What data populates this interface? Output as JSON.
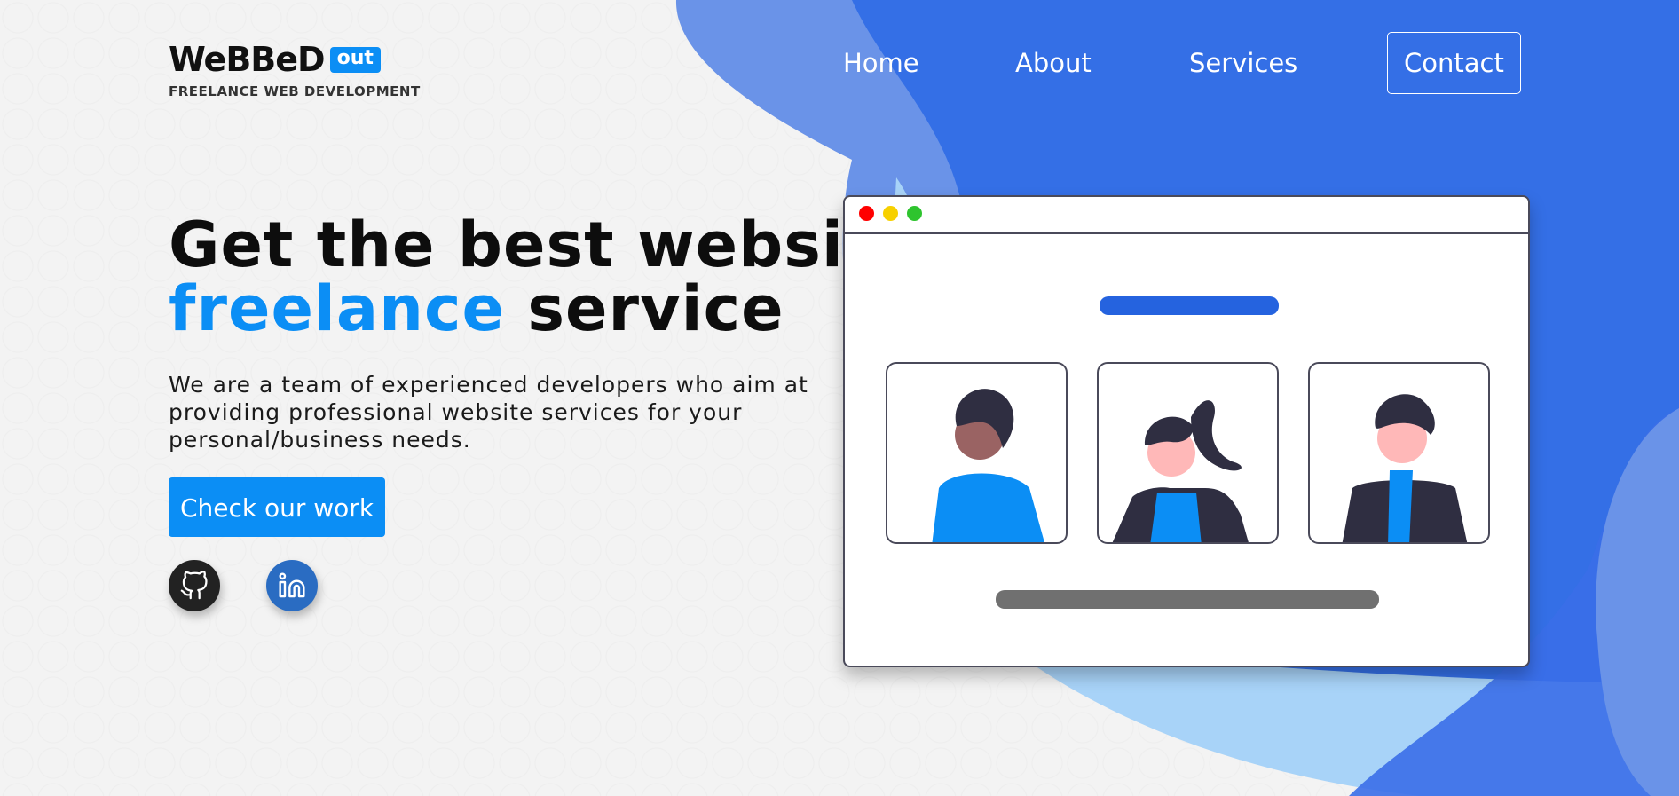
{
  "brand": {
    "name": "WeBBeD",
    "badge": "out",
    "tagline": "FREELANCE WEB DEVELOPMENT"
  },
  "nav": {
    "items": [
      "Home",
      "About",
      "Services"
    ],
    "contact": "Contact"
  },
  "hero": {
    "title_line1": "Get the best website",
    "title_accent": "freelance",
    "title_rest": "service",
    "description": "We are a team of experienced developers who aim at providing professional website services for your personal/business needs.",
    "cta": "Check our work"
  },
  "social": {
    "github_icon": "github-icon",
    "linkedin_icon": "linkedin-icon"
  },
  "colors": {
    "accent": "#0b8ef5",
    "blob_blue": "#3a6ee8",
    "light_blob": "#a6d2f8"
  }
}
